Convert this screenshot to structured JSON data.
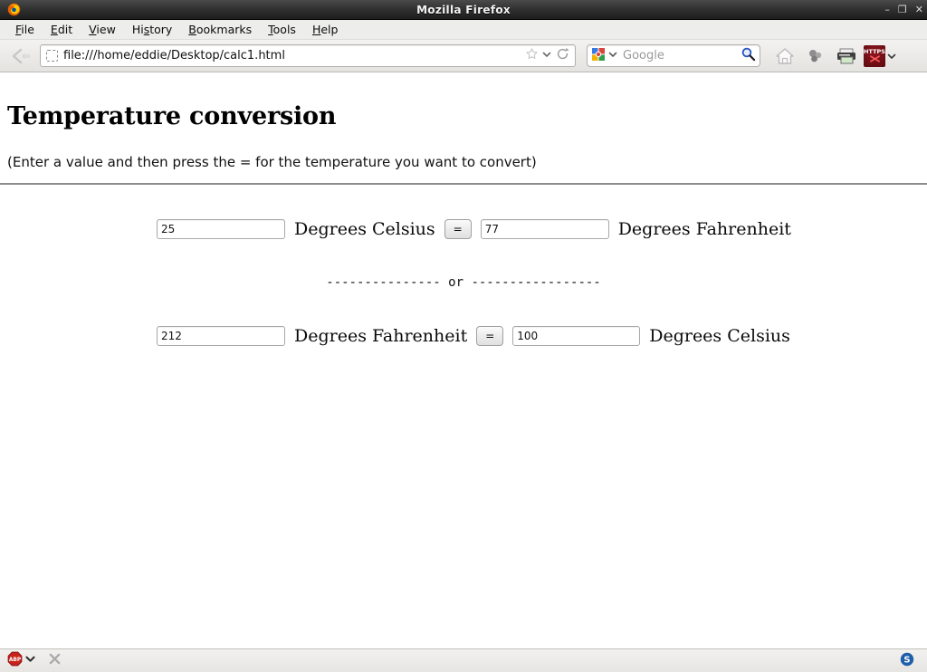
{
  "window": {
    "title": "Mozilla Firefox",
    "app_icon": "firefox-icon",
    "controls": {
      "minimize": "–",
      "restore": "❐",
      "close": "✕"
    }
  },
  "menubar": {
    "items": [
      {
        "label": "File",
        "accesskey": "F"
      },
      {
        "label": "Edit",
        "accesskey": "E"
      },
      {
        "label": "History",
        "accesskey": "s"
      },
      {
        "label": "View",
        "accesskey": "V"
      },
      {
        "label": "Bookmarks",
        "accesskey": "B"
      },
      {
        "label": "Tools",
        "accesskey": "T"
      },
      {
        "label": "Help",
        "accesskey": "H"
      }
    ],
    "order": [
      "File",
      "Edit",
      "View",
      "History",
      "Bookmarks",
      "Tools",
      "Help"
    ]
  },
  "navbar": {
    "back_icon": "back-arrow-icon",
    "url": "file:///home/eddie/Desktop/calc1.html",
    "favicon": "dashed-placeholder-favicon",
    "bookmark_icon": "star-icon",
    "bookmark_dropdown_icon": "chevron-down-icon",
    "reload_icon": "reload-icon",
    "search": {
      "engine": "Google",
      "engine_icon": "google-icon",
      "placeholder": "Google",
      "value": "",
      "dropdown_icon": "chevron-down-icon",
      "go_icon": "magnifier-icon"
    },
    "buttons": [
      {
        "name": "home-icon",
        "label": "Home"
      },
      {
        "name": "bubbles-icon",
        "label": "Add-on"
      },
      {
        "name": "printer-icon",
        "label": "Print"
      }
    ],
    "https_everywhere": {
      "label": "HTTPS",
      "icon": "https-everywhere-icon",
      "dropdown_icon": "chevron-down-icon",
      "color": "#6e0d12"
    }
  },
  "page": {
    "title": "Temperature conversion",
    "intro": "(Enter a value and then press the = for the temperature you want to convert)",
    "separator": {
      "left_dashes": "---------------",
      "word": "or",
      "right_dashes": "-----------------"
    },
    "rows": [
      {
        "input_value": "25",
        "input_placeholder": "",
        "from_label": "Degrees Celsius",
        "button_label": "=",
        "result_value": "77",
        "result_placeholder": "",
        "to_label": "Degrees Fahrenheit"
      },
      {
        "input_value": "212",
        "input_placeholder": "",
        "from_label": "Degrees Fahrenheit",
        "button_label": "=",
        "result_value": "100",
        "result_placeholder": "",
        "to_label": "Degrees Celsius"
      }
    ]
  },
  "statusbar": {
    "adblock": {
      "label": "ABP",
      "icon": "adblock-plus-icon",
      "dropdown_icon": "chevron-down-icon",
      "color": "#c9221c"
    },
    "stop_icon": "close-x-icon",
    "skype": {
      "icon": "skype-s-icon",
      "label": "S",
      "color": "#1f5fa9"
    }
  }
}
